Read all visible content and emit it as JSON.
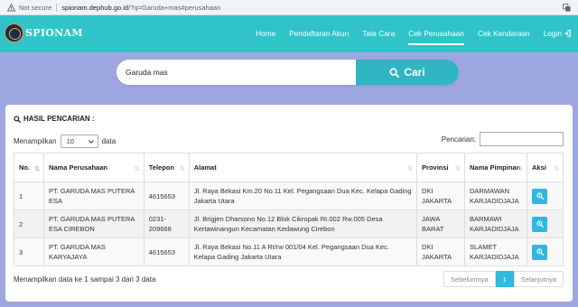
{
  "browser": {
    "security_label": "Not secure",
    "url_host": "spionam.dephub.go.id",
    "url_rest": "/?q=Garuda+mas#perusahaan"
  },
  "brand": {
    "name": "SPIONAM"
  },
  "nav": {
    "items": [
      {
        "label": "Home"
      },
      {
        "label": "Pendaftaran Akun"
      },
      {
        "label": "Tata Cara"
      },
      {
        "label": "Cek Perusahaan"
      },
      {
        "label": "Cek Kendaraan"
      },
      {
        "label": "Login"
      }
    ],
    "active": "Cek Perusahaan"
  },
  "search": {
    "value": "Garuda mas",
    "button_label": "Cari"
  },
  "results": {
    "title": "HASIL PENCARIAN :",
    "length_prefix": "Menampilkan",
    "length_value": "10",
    "length_suffix": "data",
    "filter_label": "Pencarian:",
    "columns": [
      "No.",
      "Nama Perusahaan",
      "Telepon",
      "Alamat",
      "Provinsi",
      "Nama Pimpinan",
      "Aksi"
    ],
    "rows": [
      {
        "no": "1",
        "nama": "PT. GARUDA MAS PUTERA ESA",
        "telepon": "4615653",
        "alamat": "Jl. Raya Bekasi Km.20 No.11 Kel. Pegangsaan Dua Kec. Kelapa Gading Jakarta Utara",
        "provinsi": "DKI JAKARTA",
        "pimpinan": "DARMAWAN KARJADIDJAJA"
      },
      {
        "no": "2",
        "nama": "PT. GARUDA MAS PUTERA ESA CIREBON",
        "telepon": "0231-209668",
        "alamat": "Jl. Brigjen Dharsono No.12 Blok Cikropak Rt.002 Rw.005 Desa Kertawinangun Kecamatan Kedawung Cirebon",
        "provinsi": "JAWA BARAT",
        "pimpinan": "BARMAWI KARJADIDJAJA"
      },
      {
        "no": "3",
        "nama": "PT. GARUDA MAS KARYAJAYA",
        "telepon": "4615653",
        "alamat": "Jl. Raya Bekasi No.11 A Rt/rw 001/04 Kel. Pegangsaan Dua Kec. Kelapa Gading Jakarta Utara",
        "provinsi": "DKI JAKARTA",
        "pimpinan": "SLAMET KARJADIDJAJA"
      }
    ],
    "info": "Menampilkan data ke 1 sampai 3 dari 3 data",
    "pager": {
      "prev": "Sebelumnya",
      "current": "1",
      "next": "Selanjutnya"
    }
  },
  "colors": {
    "navbar": "#30c3c8",
    "page_background": "#9ea6e0",
    "accent": "#30b9e0",
    "search_button": "#30b5c2"
  }
}
